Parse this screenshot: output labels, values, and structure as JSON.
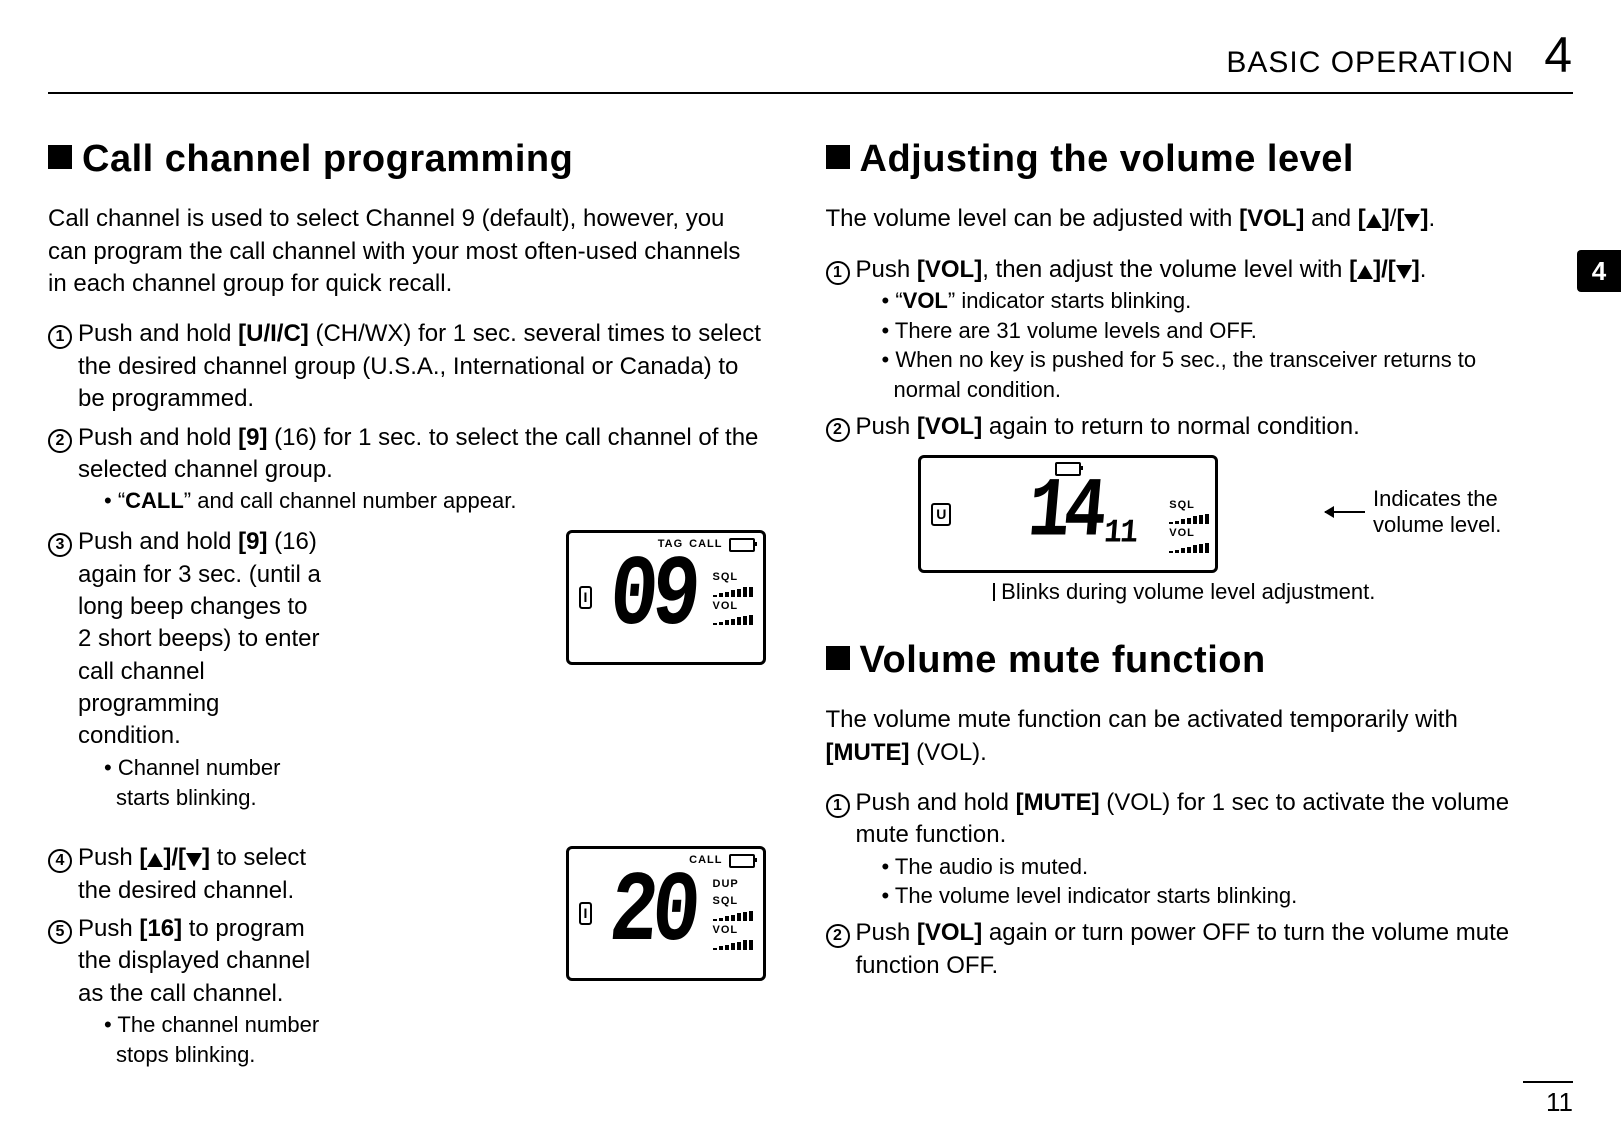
{
  "header": {
    "section": "BASIC OPERATION",
    "chapter": "4"
  },
  "thumb_tab": "4",
  "page_number": "11",
  "triangle_alt_up": "▲",
  "triangle_alt_down": "▼",
  "left": {
    "heading": "Call channel programming",
    "intro": "Call channel is used to select Channel 9 (default), however, you can program the call channel with your most often-used channels in each channel group for quick recall.",
    "steps": {
      "s1_prefix": "Push and hold ",
      "s1_key": "[U/I/C]",
      "s1_after": " (CH/WX) for 1 sec. several times to select the desired channel group (U.S.A., International or Canada) to be programmed.",
      "s2_prefix": "Push and hold ",
      "s2_key": "[9]",
      "s2_after": " (16) for 1 sec. to select the call channel of the selected channel group.",
      "s2_sub_prefix": "• “",
      "s2_sub_key": "CALL",
      "s2_sub_after": "” and call channel number appear.",
      "s3_prefix": "Push and hold ",
      "s3_key": "[9]",
      "s3_after": " (16) again for 3 sec. (until a long beep changes to 2 short beeps) to enter call channel programming condition.",
      "s3_sub": "• Channel number starts blinking.",
      "s4_prefix": "Push ",
      "s4_mid": " to select the desired channel.",
      "s5_prefix": "Push ",
      "s5_key": "[16]",
      "s5_after": " to program the displayed channel as the call channel.",
      "s5_sub": "• The channel number stops blinking."
    },
    "lcd1": {
      "digits": "09",
      "left_badge": "I",
      "tag_text": "TAG",
      "call_text": "CALL",
      "sq_label": "SQL",
      "vol_label": "VOL"
    },
    "lcd2": {
      "digits": "20",
      "left_badge": "I",
      "call_text": "CALL",
      "dup_text": "DUP",
      "sq_label": "SQL",
      "vol_label": "VOL"
    }
  },
  "right": {
    "heading_adjust": "Adjusting the volume level",
    "adjust_intro_pre": "The volume level can be adjusted with ",
    "adjust_intro_key1": "[VOL]",
    "adjust_intro_mid": " and ",
    "adjust_intro_end": ".",
    "adj_s1_prefix": "Push ",
    "adj_s1_key": "[VOL]",
    "adj_s1_mid": ", then adjust the volume level with ",
    "adj_s1_end": ".",
    "adj_s1_sub1_pre": "• “",
    "adj_s1_sub1_key": "VOL",
    "adj_s1_sub1_post": "” indicator starts blinking.",
    "adj_s1_sub2": "• There are 31 volume levels and OFF.",
    "adj_s1_sub3": "• When no key is pushed for 5 sec., the transceiver returns to normal condition.",
    "adj_s2_prefix": "Push ",
    "adj_s2_key": "[VOL]",
    "adj_s2_after": " again to return to normal condition.",
    "lcd": {
      "left_badge": "U",
      "big_digits": "14",
      "small_digits": "11",
      "sq_label": "SQL",
      "vol_label": "VOL"
    },
    "annotation_a": "Indicates the volume level.",
    "annotation_b": "Blinks during volume level adjustment.",
    "heading_mute": "Volume mute function",
    "mute_intro_pre": "The volume mute function can be activated temporarily with ",
    "mute_intro_key": "[MUTE]",
    "mute_intro_post": " (VOL).",
    "mute_s1_prefix": "Push and hold ",
    "mute_s1_key": "[MUTE]",
    "mute_s1_after": " (VOL) for 1 sec to activate the volume mute function.",
    "mute_s1_sub1": "• The audio is muted.",
    "mute_s1_sub2": "• The volume level indicator starts blinking.",
    "mute_s2_prefix": "Push ",
    "mute_s2_key": "[VOL]",
    "mute_s2_after": " again or turn power OFF to turn the volume mute function OFF."
  }
}
